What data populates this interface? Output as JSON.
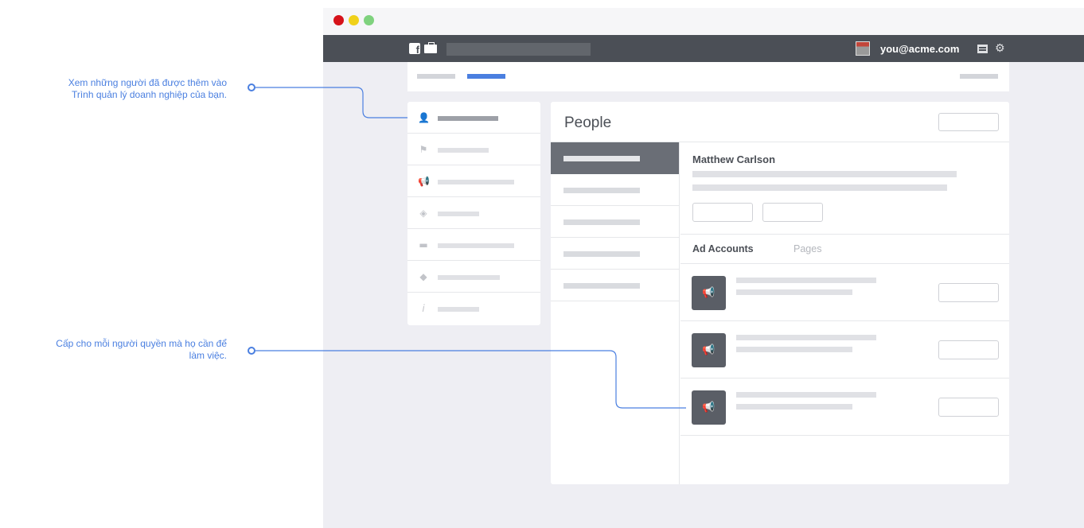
{
  "annotations": {
    "people": {
      "lines": [
        "Xem những người đã được thêm vào",
        "Trình quản lý doanh nghiệp của bạn."
      ]
    },
    "permissions": {
      "lines": [
        "Cấp cho mỗi người quyền mà họ cần để",
        "làm việc."
      ]
    }
  },
  "topbar": {
    "user_email": "you@acme.com",
    "icons": [
      "facebook-icon",
      "briefcase-icon",
      "grid-icon",
      "gear-icon"
    ]
  },
  "sidebar": {
    "items": [
      {
        "icon": "person-icon",
        "active": true
      },
      {
        "icon": "flag-icon",
        "active": false
      },
      {
        "icon": "megaphone-icon",
        "active": false
      },
      {
        "icon": "box-icon",
        "active": false
      },
      {
        "icon": "card-icon",
        "active": false
      },
      {
        "icon": "tag-icon",
        "active": false
      },
      {
        "icon": "info-icon",
        "active": false
      }
    ]
  },
  "panel": {
    "title": "People",
    "selected_person": "Matthew Carlson",
    "tabs": [
      {
        "label": "Ad Accounts",
        "active": true
      },
      {
        "label": "Pages",
        "active": false
      }
    ],
    "accounts": [
      {
        "icon": "megaphone-icon"
      },
      {
        "icon": "megaphone-icon"
      },
      {
        "icon": "megaphone-icon"
      }
    ]
  },
  "colors": {
    "accent": "#4a7fe0",
    "topbar": "#4b4f56",
    "window_bg": "#eeeef3"
  }
}
